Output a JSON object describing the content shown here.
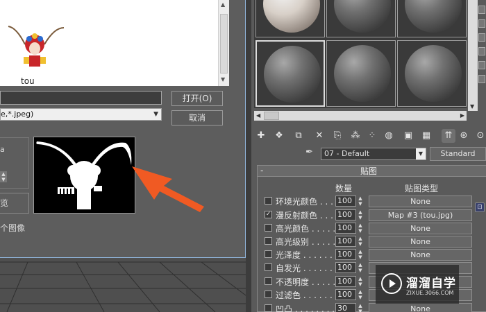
{
  "dialog": {
    "file_name": "tou",
    "filename_value": "",
    "file_type": "e,*.jpeg)",
    "open_button": "打开(O)",
    "cancel_button": "取消",
    "left_label": "a",
    "left_button": "览",
    "left_caption": "个图像"
  },
  "material_editor": {
    "material_name": "07 - Default",
    "material_type": "Standard",
    "rollout_title": "贴图",
    "columns": {
      "amount": "数量",
      "map_type": "贴图类型"
    },
    "maps": [
      {
        "name": "环境光颜色 . . . .",
        "checked": false,
        "amount": "100",
        "map": "None"
      },
      {
        "name": "漫反射颜色 . . .",
        "checked": true,
        "amount": "100",
        "map": "Map #3 (tou.jpg)"
      },
      {
        "name": "高光颜色 . . . . . .",
        "checked": false,
        "amount": "100",
        "map": "None"
      },
      {
        "name": "高光级别 . . . . . .",
        "checked": false,
        "amount": "100",
        "map": "None"
      },
      {
        "name": "光泽度 . . . . . . . .",
        "checked": false,
        "amount": "100",
        "map": "None"
      },
      {
        "name": "自发光 . . . . . . . .",
        "checked": false,
        "amount": "100",
        "map": ""
      },
      {
        "name": "不透明度 . . . . . .",
        "checked": false,
        "amount": "100",
        "map": ""
      },
      {
        "name": "过滤色 . . . . . . . .",
        "checked": false,
        "amount": "100",
        "map": ""
      },
      {
        "name": "凹凸 . . . . . . . . . .",
        "checked": false,
        "amount": "30",
        "map": "None"
      }
    ]
  },
  "watermark": {
    "title": "溜溜自学",
    "url": "ZIXUE.3066.COM"
  },
  "colors": {
    "annotation_arrow": "#f05a23",
    "panel_bg": "#5a5a5a"
  }
}
